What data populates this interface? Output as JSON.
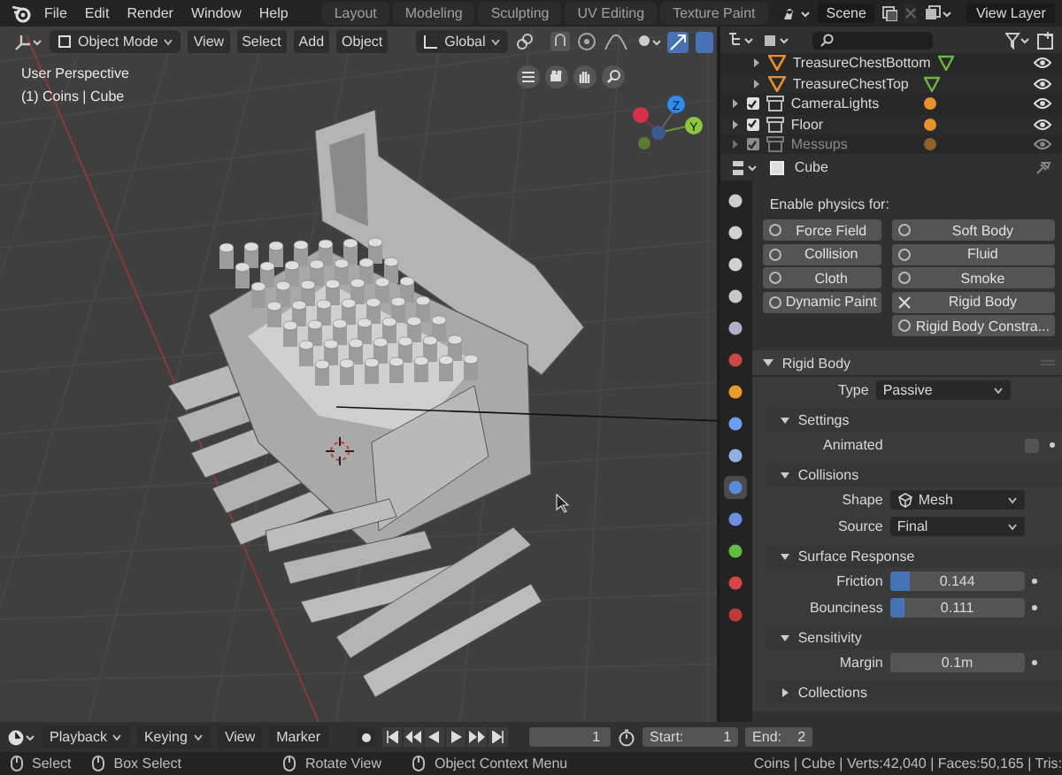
{
  "topbar": {
    "menus": [
      "File",
      "Edit",
      "Render",
      "Window",
      "Help"
    ],
    "workspaces": [
      {
        "label": "Layout",
        "selected": false
      },
      {
        "label": "Modeling",
        "selected": false
      },
      {
        "label": "Sculpting",
        "selected": false
      },
      {
        "label": "UV Editing",
        "selected": false
      },
      {
        "label": "Texture Paint",
        "selected": false
      }
    ],
    "scene": "Scene",
    "view_layer": "View Layer"
  },
  "viewport": {
    "header": {
      "mode": "Object Mode",
      "menus": [
        "View",
        "Select",
        "Add",
        "Object"
      ],
      "orientation": "Global"
    },
    "overlay_text": [
      "User Perspective",
      "(1) Coins | Cube"
    ],
    "gizmo_labels": [
      "Z",
      "Y"
    ]
  },
  "outliner": {
    "rows": [
      {
        "name": "TreasureChestBottom",
        "kind": "object"
      },
      {
        "name": "TreasureChestTop",
        "kind": "object"
      },
      {
        "name": "CameraLights",
        "kind": "collection",
        "checked": true
      },
      {
        "name": "Floor",
        "kind": "collection",
        "checked": true
      },
      {
        "name": "Messups",
        "kind": "collection",
        "checked": true
      }
    ]
  },
  "properties": {
    "object_name": "Cube",
    "tabs": [
      {
        "kind": "tool",
        "selected": false
      },
      {
        "kind": "render",
        "selected": false
      },
      {
        "kind": "output",
        "selected": false
      },
      {
        "kind": "view_layer",
        "selected": false
      },
      {
        "kind": "scene",
        "selected": false
      },
      {
        "kind": "world",
        "selected": false
      },
      {
        "kind": "object",
        "selected": false
      },
      {
        "kind": "modifiers",
        "selected": false
      },
      {
        "kind": "particles",
        "selected": false
      },
      {
        "kind": "physics",
        "selected": true
      },
      {
        "kind": "constraints",
        "selected": false
      },
      {
        "kind": "data",
        "selected": false
      },
      {
        "kind": "material",
        "selected": false
      },
      {
        "kind": "texture",
        "selected": false
      }
    ],
    "physics_heading": "Enable physics for:",
    "left_column": [
      {
        "label": "Force Field",
        "enabled": false
      },
      {
        "label": "Collision",
        "enabled": false
      },
      {
        "label": "Cloth",
        "enabled": false
      },
      {
        "label": "Dynamic Paint",
        "enabled": false
      }
    ],
    "right_column": [
      {
        "label": "Soft Body",
        "enabled": false
      },
      {
        "label": "Fluid",
        "enabled": false
      },
      {
        "label": "Smoke",
        "enabled": false
      },
      {
        "label": "Rigid Body",
        "enabled": true
      },
      {
        "label": "Rigid Body Constra...",
        "enabled": false
      }
    ],
    "panel": {
      "title": "Rigid Body",
      "expanded": true,
      "rows": [
        {
          "kind": "dropdown",
          "label": "Type",
          "value": "Passive"
        }
      ],
      "subpanels": [
        {
          "title": "Settings",
          "expanded": true,
          "rows": [
            {
              "kind": "checkbox",
              "label": "Animated",
              "checked": false
            }
          ]
        },
        {
          "title": "Collisions",
          "expanded": true,
          "rows": [
            {
              "kind": "icon_dropdown",
              "label": "Shape",
              "value": "Mesh"
            },
            {
              "kind": "dropdown",
              "label": "Source",
              "value": "Final"
            }
          ]
        },
        {
          "title": "Surface Response",
          "expanded": true,
          "rows": [
            {
              "kind": "slider",
              "label": "Friction",
              "value": "0.144",
              "level": 0.144
            },
            {
              "kind": "slider",
              "label": "Bounciness",
              "value": "0.111",
              "level": 0.111
            }
          ]
        },
        {
          "title": "Sensitivity",
          "expanded": true,
          "rows": [
            {
              "kind": "number",
              "label": "Margin",
              "value": "0.1m"
            }
          ]
        },
        {
          "title": "Collections",
          "expanded": false
        }
      ]
    }
  },
  "timeline": {
    "menus": [
      {
        "label": "Playback",
        "dropdown": true
      },
      {
        "label": "Keying",
        "dropdown": true
      },
      {
        "label": "View",
        "dropdown": false
      },
      {
        "label": "Marker",
        "dropdown": false
      }
    ],
    "current_frame": "1",
    "start_label": "Start:",
    "start": "1",
    "end_label": "End:",
    "end": "2"
  },
  "status_bar": {
    "hints": [
      "Select",
      "Box Select",
      "Rotate View",
      "Object Context Menu"
    ],
    "stats": "Coins | Cube | Verts:42,040 | Faces:50,165 | Tris:"
  }
}
